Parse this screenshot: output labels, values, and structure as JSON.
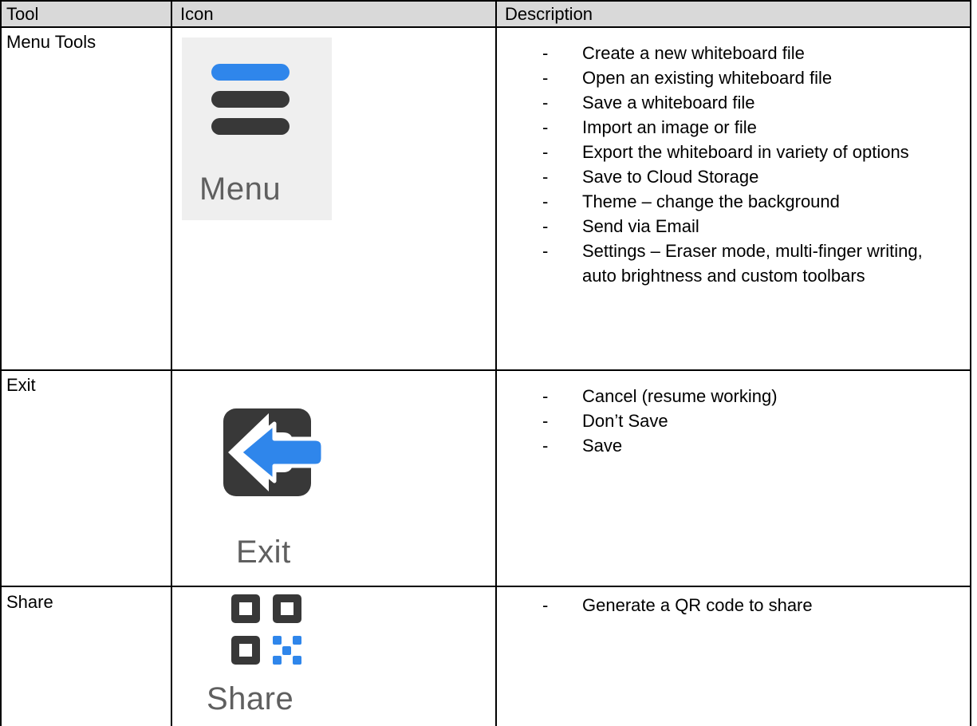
{
  "table": {
    "headers": {
      "tool": "Tool",
      "icon": "Icon",
      "description": "Description"
    },
    "rows": [
      {
        "tool": "Menu Tools",
        "icon_label": "Menu",
        "icon_name": "hamburger-menu-icon",
        "items": [
          "Create a new whiteboard file",
          "Open an existing whiteboard file",
          "Save a whiteboard file",
          "Import an image or file",
          "Export the whiteboard in variety of options",
          "Save to Cloud Storage",
          "Theme – change the background",
          "Send via Email",
          "Settings – Eraser mode, multi-finger writing, auto brightness and custom toolbars"
        ]
      },
      {
        "tool": "Exit",
        "icon_label": "Exit",
        "icon_name": "exit-arrow-icon",
        "items": [
          "Cancel (resume working)",
          "Don’t Save",
          "Save"
        ]
      },
      {
        "tool": "Share",
        "icon_label": "Share",
        "icon_name": "qr-code-icon",
        "items": [
          "Generate a QR code to share"
        ]
      }
    ],
    "bullet": "-"
  },
  "colors": {
    "accent_blue": "#2f86eb",
    "icon_dark": "#383838",
    "icon_label_gray": "#5f5f5f",
    "menu_panel_bg": "#efefef"
  }
}
